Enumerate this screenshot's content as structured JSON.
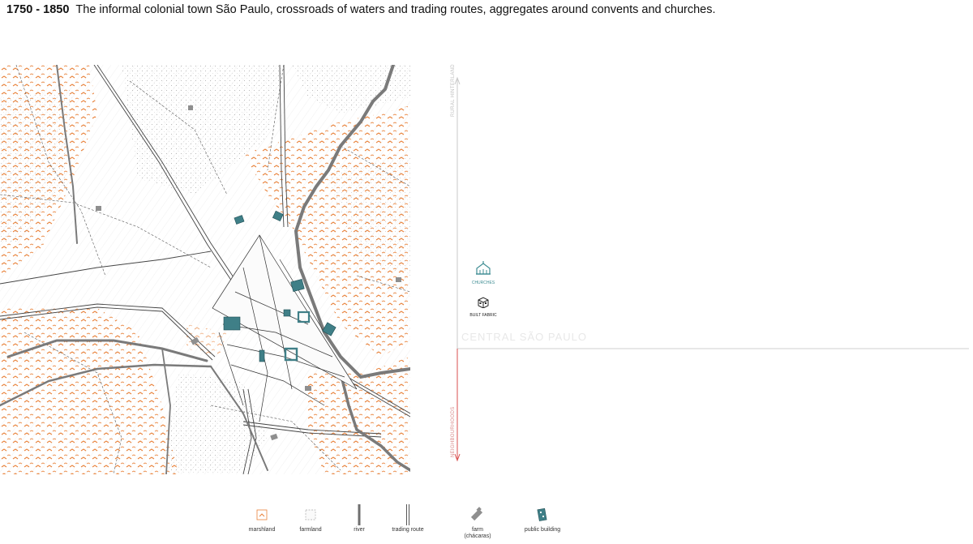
{
  "header": {
    "years": "1750 - 1850",
    "caption": "The informal colonial town São Paulo, crossroads of waters and trading routes, aggregates around convents and churches."
  },
  "diagram": {
    "axis_up_label": "RURAL HINTERLAND",
    "axis_down_label": "NEIGHBOURHOODS",
    "central_label": "CENTRAL SÃO PAULO",
    "icons": [
      {
        "name": "churches",
        "label": "CHURCHES",
        "color": "#3f8d93"
      },
      {
        "name": "public-building",
        "label": "BUILT FABRIC",
        "color": "#222222"
      }
    ]
  },
  "legend": [
    {
      "name": "marshland",
      "label": "marshland"
    },
    {
      "name": "farmland",
      "label": "farmland"
    },
    {
      "name": "river",
      "label": "river"
    },
    {
      "name": "trading-route",
      "label": "trading route"
    },
    {
      "name": "farm",
      "label": "farm",
      "sublabel": "(chácaras)"
    },
    {
      "name": "public-building",
      "label": "public building"
    }
  ],
  "colors": {
    "marsh": "#e8823a",
    "river": "#7a7a7a",
    "building": "#3f7f87",
    "axis_red": "#d94f4f",
    "axis_gray": "#c8c8c8"
  }
}
